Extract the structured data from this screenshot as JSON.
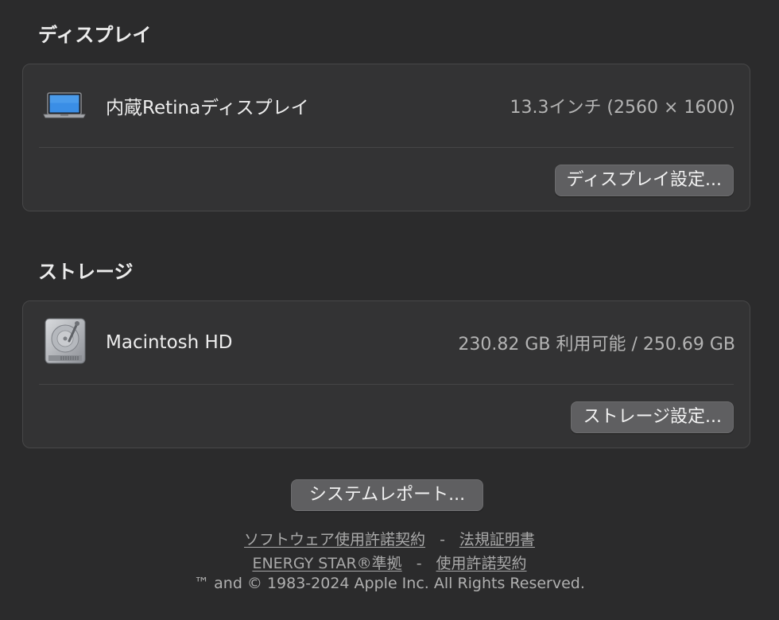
{
  "display": {
    "section_title": "ディスプレイ",
    "name": "内蔵Retinaディスプレイ",
    "value": "13.3インチ (2560 × 1600)",
    "settings_button": "ディスプレイ設定...",
    "icon": "laptop-icon"
  },
  "storage": {
    "section_title": "ストレージ",
    "name": "Macintosh HD",
    "value": "230.82 GB 利用可能 / 250.69 GB",
    "settings_button": "ストレージ設定...",
    "icon": "hard-drive-icon"
  },
  "system_report_button": "システムレポート...",
  "footer": {
    "license_link": "ソフトウェア使用許諾契約",
    "separator1": "-",
    "regulatory_link": "法規証明書",
    "energy_star_link": "ENERGY STAR®準拠",
    "separator2": "-",
    "license_link2": "使用許諾契約",
    "copyright": "™ and © 1983-2024 Apple Inc. All Rights Reserved."
  },
  "colors": {
    "background": "#2b2b2c",
    "panel": "#333334",
    "button": "#5f5f61"
  }
}
